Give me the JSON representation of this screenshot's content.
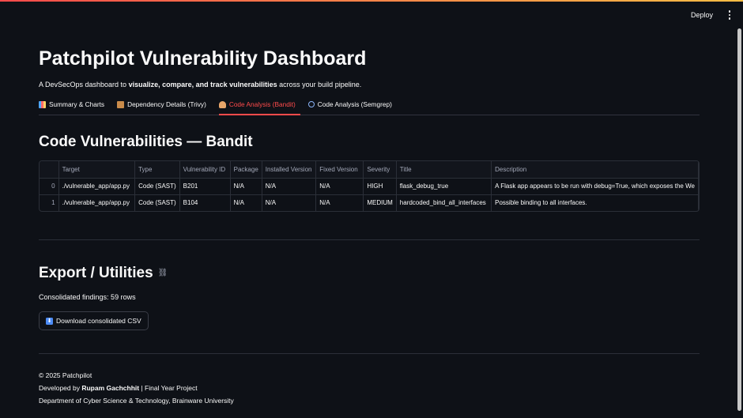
{
  "toolbar": {
    "deploy_label": "Deploy",
    "menu_icon": "kebab-menu-icon"
  },
  "header": {
    "title": "Patchpilot Vulnerability Dashboard",
    "subtitle_prefix": "A DevSecOps dashboard to ",
    "subtitle_bold": "visualize, compare, and track vulnerabilities",
    "subtitle_suffix": " across your build pipeline."
  },
  "tabs": [
    {
      "label": "Summary & Charts",
      "icon": "chart-icon",
      "active": false
    },
    {
      "label": "Dependency Details (Trivy)",
      "icon": "package-icon",
      "active": false
    },
    {
      "label": "Code Analysis (Bandit)",
      "icon": "person-icon",
      "active": true
    },
    {
      "label": "Code Analysis (Semgrep)",
      "icon": "magnifier-icon",
      "active": false
    }
  ],
  "section": {
    "title": "Code Vulnerabilities — Bandit"
  },
  "table": {
    "columns": [
      "",
      "Target",
      "Type",
      "Vulnerability ID",
      "Package",
      "Installed Version",
      "Fixed Version",
      "Severity",
      "Title",
      "Description"
    ],
    "rows": [
      [
        "0",
        "./vulnerable_app/app.py",
        "Code (SAST)",
        "B201",
        "N/A",
        "N/A",
        "N/A",
        "HIGH",
        "flask_debug_true",
        "A Flask app appears to be run with debug=True, which exposes the We"
      ],
      [
        "1",
        "./vulnerable_app/app.py",
        "Code (SAST)",
        "B104",
        "N/A",
        "N/A",
        "N/A",
        "MEDIUM",
        "hardcoded_bind_all_interfaces",
        "Possible binding to all interfaces."
      ]
    ]
  },
  "export": {
    "title": "Export / Utilities",
    "rows_info": "Consolidated findings: 59 rows",
    "download_label": "Download consolidated CSV"
  },
  "footer": {
    "copyright": "© 2025 Patchpilot",
    "dev_prefix": "Developed by ",
    "dev_name": "Rupam Gachchhit",
    "dev_suffix": " | Final Year Project",
    "dept": "Department of Cyber Science & Technology, Brainware University"
  },
  "colors": {
    "background": "#0e1117",
    "accent": "#ff4b4b",
    "border": "#2b2f38"
  }
}
